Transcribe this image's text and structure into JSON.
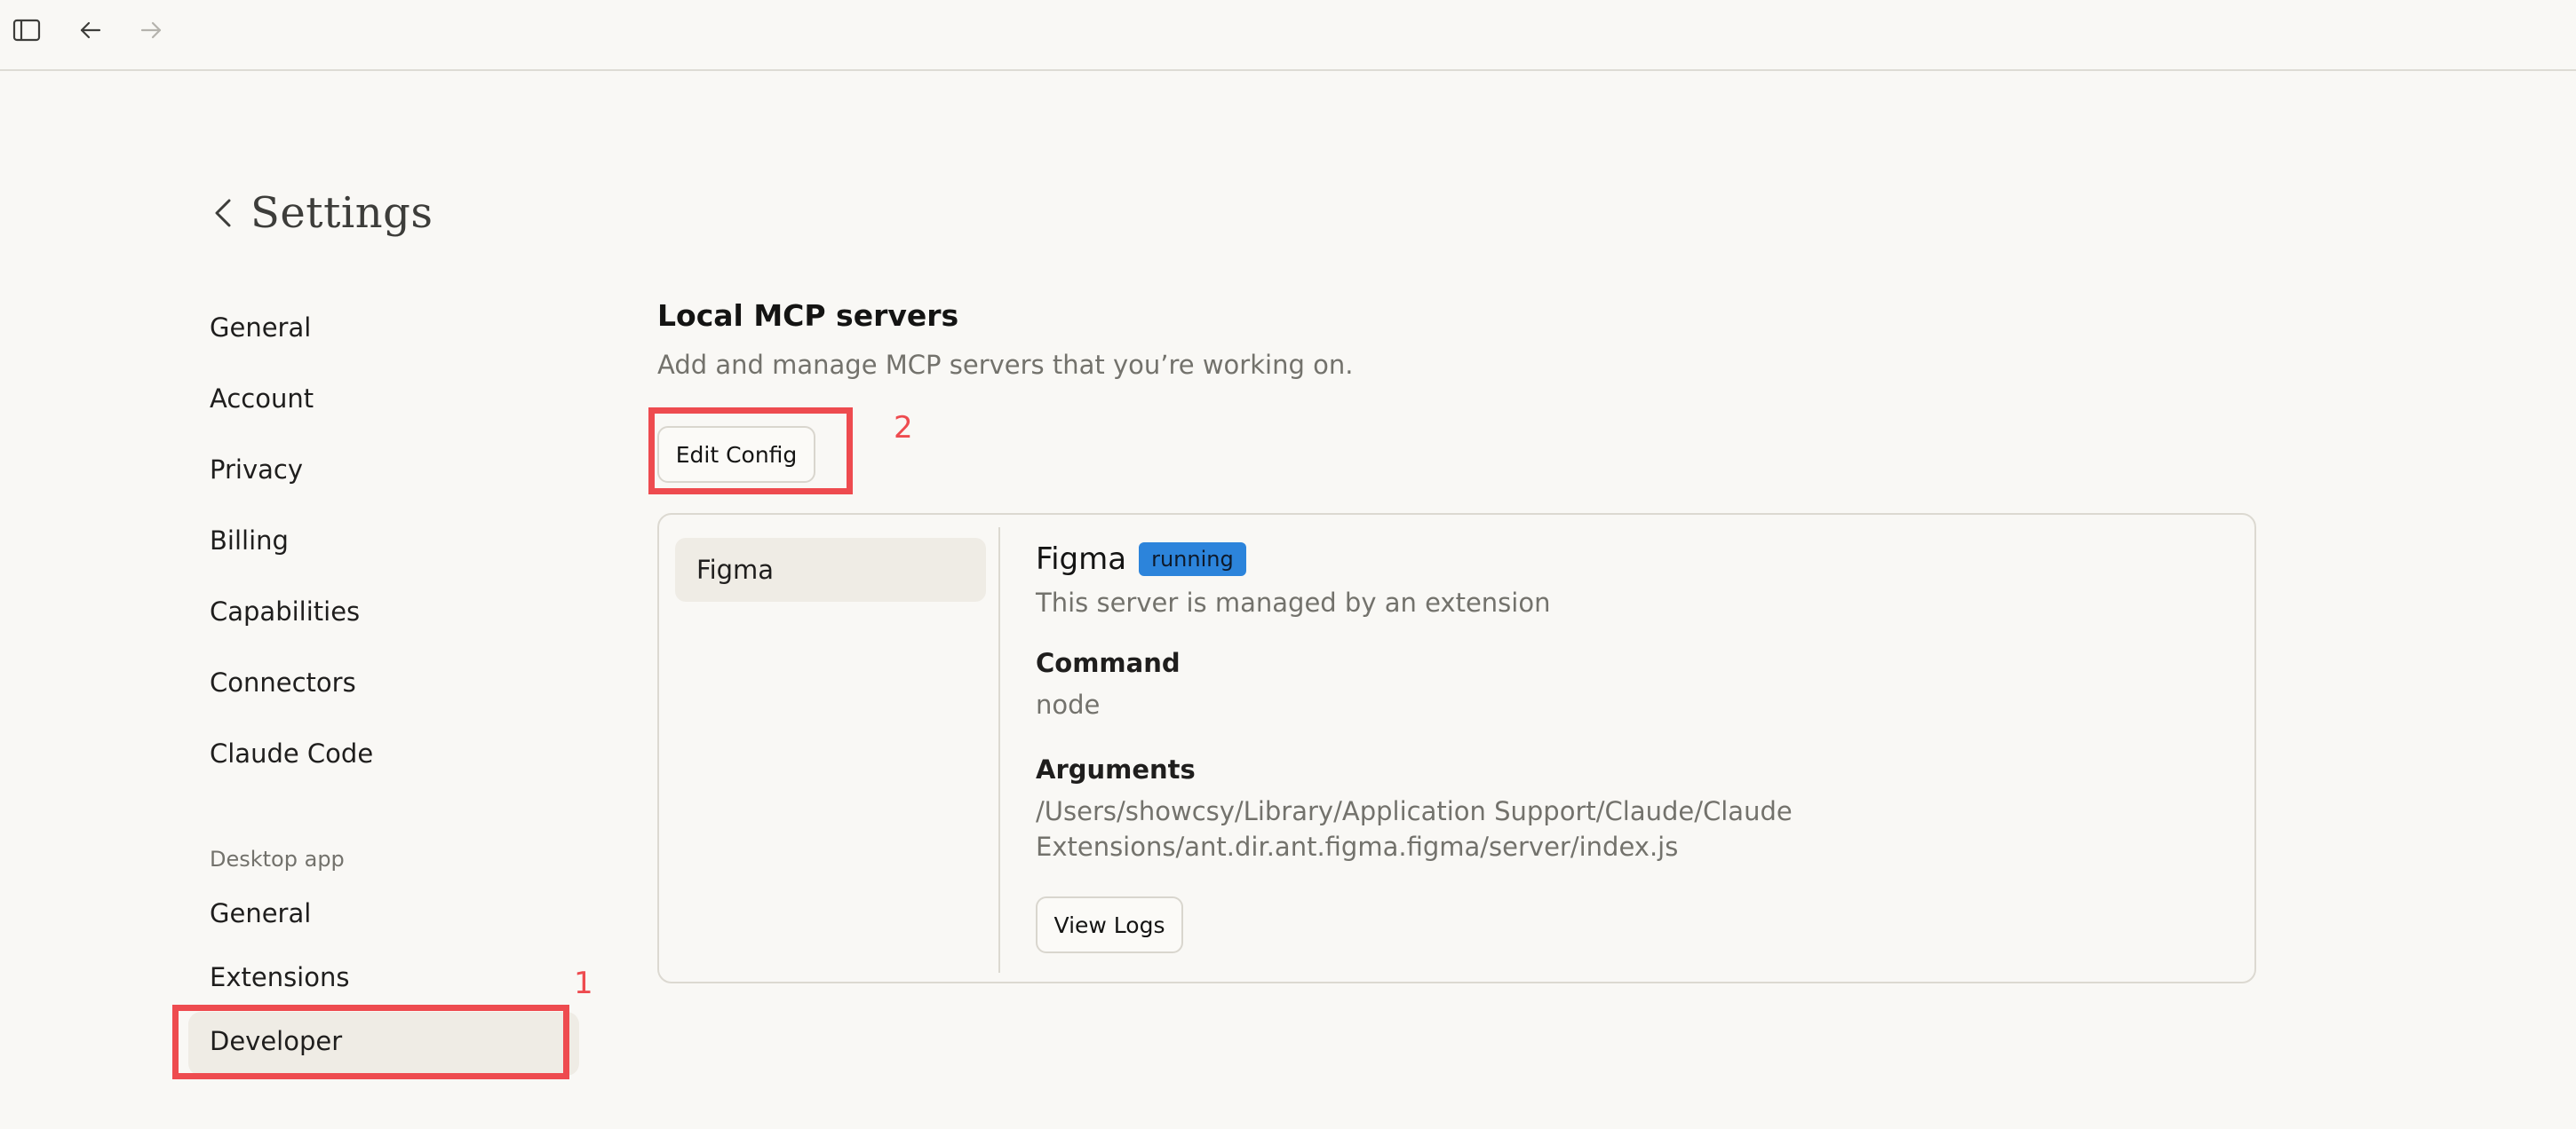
{
  "titlebar": {
    "sidebar_toggle_icon": "sidebar-toggle-icon",
    "back_icon": "arrow-left-icon",
    "forward_icon": "arrow-right-icon"
  },
  "header": {
    "back_icon": "chevron-left-icon",
    "title": "Settings"
  },
  "nav": {
    "items": [
      {
        "label": "General"
      },
      {
        "label": "Account"
      },
      {
        "label": "Privacy"
      },
      {
        "label": "Billing"
      },
      {
        "label": "Capabilities"
      },
      {
        "label": "Connectors"
      },
      {
        "label": "Claude Code"
      }
    ],
    "desktop_section_label": "Desktop app",
    "desktop_items": [
      {
        "label": "General"
      },
      {
        "label": "Extensions"
      },
      {
        "label": "Developer",
        "active": true
      }
    ]
  },
  "annotations": {
    "one": "1",
    "two": "2",
    "color": "#ee4b4f"
  },
  "main": {
    "section_title": "Local MCP servers",
    "section_desc": "Add and manage MCP servers that you’re working on.",
    "edit_config_label": "Edit Config",
    "servers": [
      {
        "name": "Figma",
        "selected": true
      }
    ],
    "detail": {
      "name": "Figma",
      "status": "running",
      "status_color": "#2c84db",
      "subtitle": "This server is managed by an extension",
      "command_label": "Command",
      "command_value": "node",
      "arguments_label": "Arguments",
      "arguments_line1": "/Users/showcsy/Library/Application Support/Claude/Claude",
      "arguments_line2": "Extensions/ant.dir.ant.figma.figma/server/index.js",
      "view_logs_label": "View Logs"
    }
  }
}
